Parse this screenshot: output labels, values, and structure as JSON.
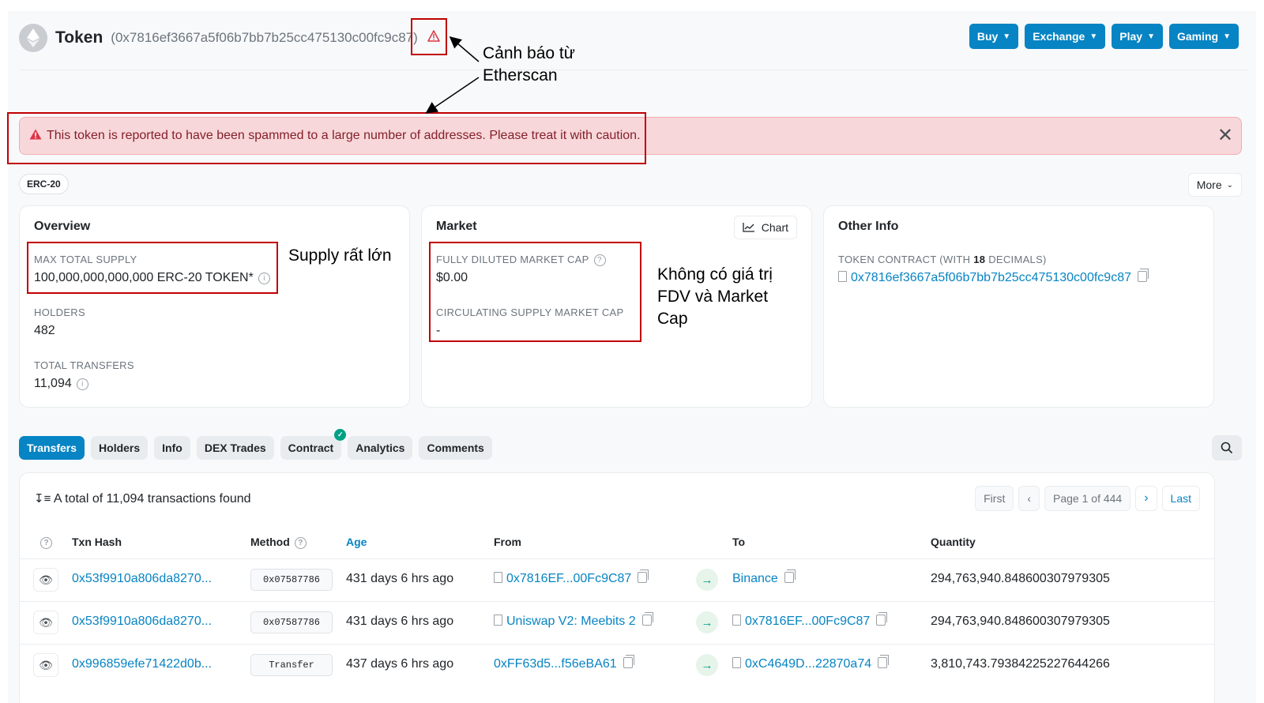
{
  "header": {
    "title": "Token",
    "address": "(0x7816ef3667a5f06b7bb7b25cc475130c00fc9c87)",
    "buttons": [
      "Buy",
      "Exchange",
      "Play",
      "Gaming"
    ]
  },
  "alert": {
    "text": "This token is reported to have been spammed to a large number of addresses. Please treat it with caution."
  },
  "badge": "ERC-20",
  "more_label": "More",
  "overview": {
    "title": "Overview",
    "max_supply_label": "MAX TOTAL SUPPLY",
    "max_supply_value": "100,000,000,000,000 ERC-20 TOKEN*",
    "holders_label": "HOLDERS",
    "holders_value": "482",
    "transfers_label": "TOTAL TRANSFERS",
    "transfers_value": "11,094"
  },
  "market": {
    "title": "Market",
    "chart_label": "Chart",
    "fdv_label": "FULLY DILUTED MARKET CAP",
    "fdv_value": "$0.00",
    "circ_label": "CIRCULATING SUPPLY MARKET CAP",
    "circ_value": "-"
  },
  "other": {
    "title": "Other Info",
    "contract_label_pre": "TOKEN CONTRACT (WITH ",
    "contract_label_bold": "18",
    "contract_label_post": " DECIMALS)",
    "contract_value": "0x7816ef3667a5f06b7bb7b25cc475130c00fc9c87"
  },
  "annotations": {
    "warning_line1": "Cảnh báo từ",
    "warning_line2": "Etherscan",
    "supply": "Supply rất lớn",
    "market_line1": "Không có giá trị",
    "market_line2": "FDV và Market",
    "market_line3": "Cap"
  },
  "tabs": [
    "Transfers",
    "Holders",
    "Info",
    "DEX Trades",
    "Contract",
    "Analytics",
    "Comments"
  ],
  "table": {
    "total_text": "A total of 11,094 transactions found",
    "pager": {
      "first": "First",
      "page": "Page 1 of 444",
      "last": "Last"
    },
    "headers": {
      "txn": "Txn Hash",
      "method": "Method",
      "age": "Age",
      "from": "From",
      "to": "To",
      "quantity": "Quantity"
    },
    "rows": [
      {
        "hash": "0x53f9910a806da8270...",
        "method": "0x07587786",
        "age": "431 days 6 hrs ago",
        "from": "0x7816EF...00Fc9C87",
        "to": "Binance",
        "quantity": "294,763,940.848600307979305"
      },
      {
        "hash": "0x53f9910a806da8270...",
        "method": "0x07587786",
        "age": "431 days 6 hrs ago",
        "from": "Uniswap V2: Meebits 2",
        "to": "0x7816EF...00Fc9C87",
        "quantity": "294,763,940.848600307979305"
      },
      {
        "hash": "0x996859efe71422d0b...",
        "method": "Transfer",
        "age": "437 days 6 hrs ago",
        "from": "0xFF63d5...f56eBA61",
        "to": "0xC4649D...22870a74",
        "quantity": "3,810,743.79384225227644266"
      }
    ]
  },
  "colors": {
    "accent": "#0784c3",
    "alert_bg": "#f8d7da",
    "alert_text": "#842029",
    "annotation_red": "#c00000"
  }
}
